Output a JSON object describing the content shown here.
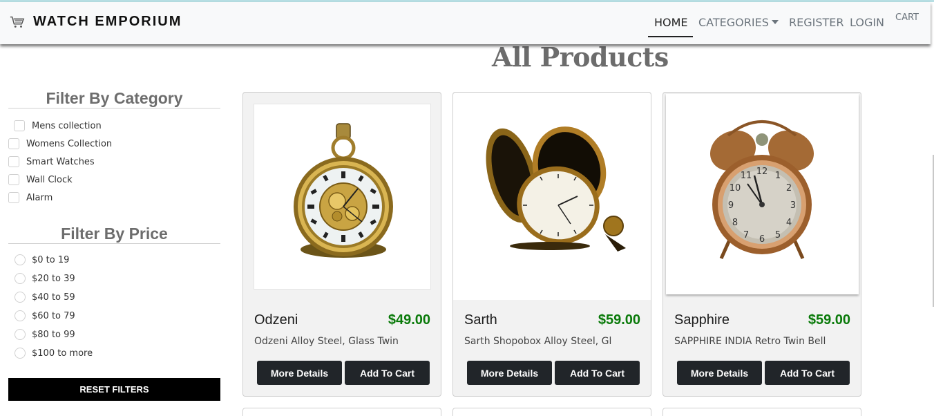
{
  "navbar": {
    "brand": "WATCH EMPORIUM",
    "brand_icon": "shopping-cart-icon",
    "links": {
      "home": "HOME",
      "categories": "CATEGORIES",
      "register": "REGISTER",
      "login": "LOGIN",
      "cart": "CART"
    }
  },
  "main": {
    "title": "All Products"
  },
  "sidebar": {
    "category_heading": "Filter By Category",
    "categories": [
      "Mens collection",
      "Womens Collection",
      "Smart Watches",
      "Wall Clock",
      "Alarm"
    ],
    "price_heading": "Filter By Price",
    "prices": [
      "$0 to 19",
      "$20 to 39",
      "$40 to 59",
      "$60 to 79",
      "$80 to 99",
      "$100 to more"
    ],
    "reset_label": "RESET FILTERS"
  },
  "products": [
    {
      "name": "Odzeni",
      "price": "$49.00",
      "description": "Odzeni Alloy Steel, Glass Twin",
      "details_label": "More Details",
      "cart_label": "Add To Cart",
      "image": "pocket-watch-skeleton"
    },
    {
      "name": "Sarth",
      "price": "$59.00",
      "description": "Sarth Shopobox Alloy Steel, Gl",
      "details_label": "More Details",
      "cart_label": "Add To Cart",
      "image": "open-pocket-watch"
    },
    {
      "name": "Sapphire",
      "price": "$59.00",
      "description": "SAPPHIRE INDIA Retro Twin Bell",
      "details_label": "More Details",
      "cart_label": "Add To Cart",
      "image": "twin-bell-alarm-clock"
    }
  ],
  "colors": {
    "price": "#0a7a0a",
    "button": "#212529",
    "reset": "#000000",
    "navbar": "#f8f9fa"
  }
}
